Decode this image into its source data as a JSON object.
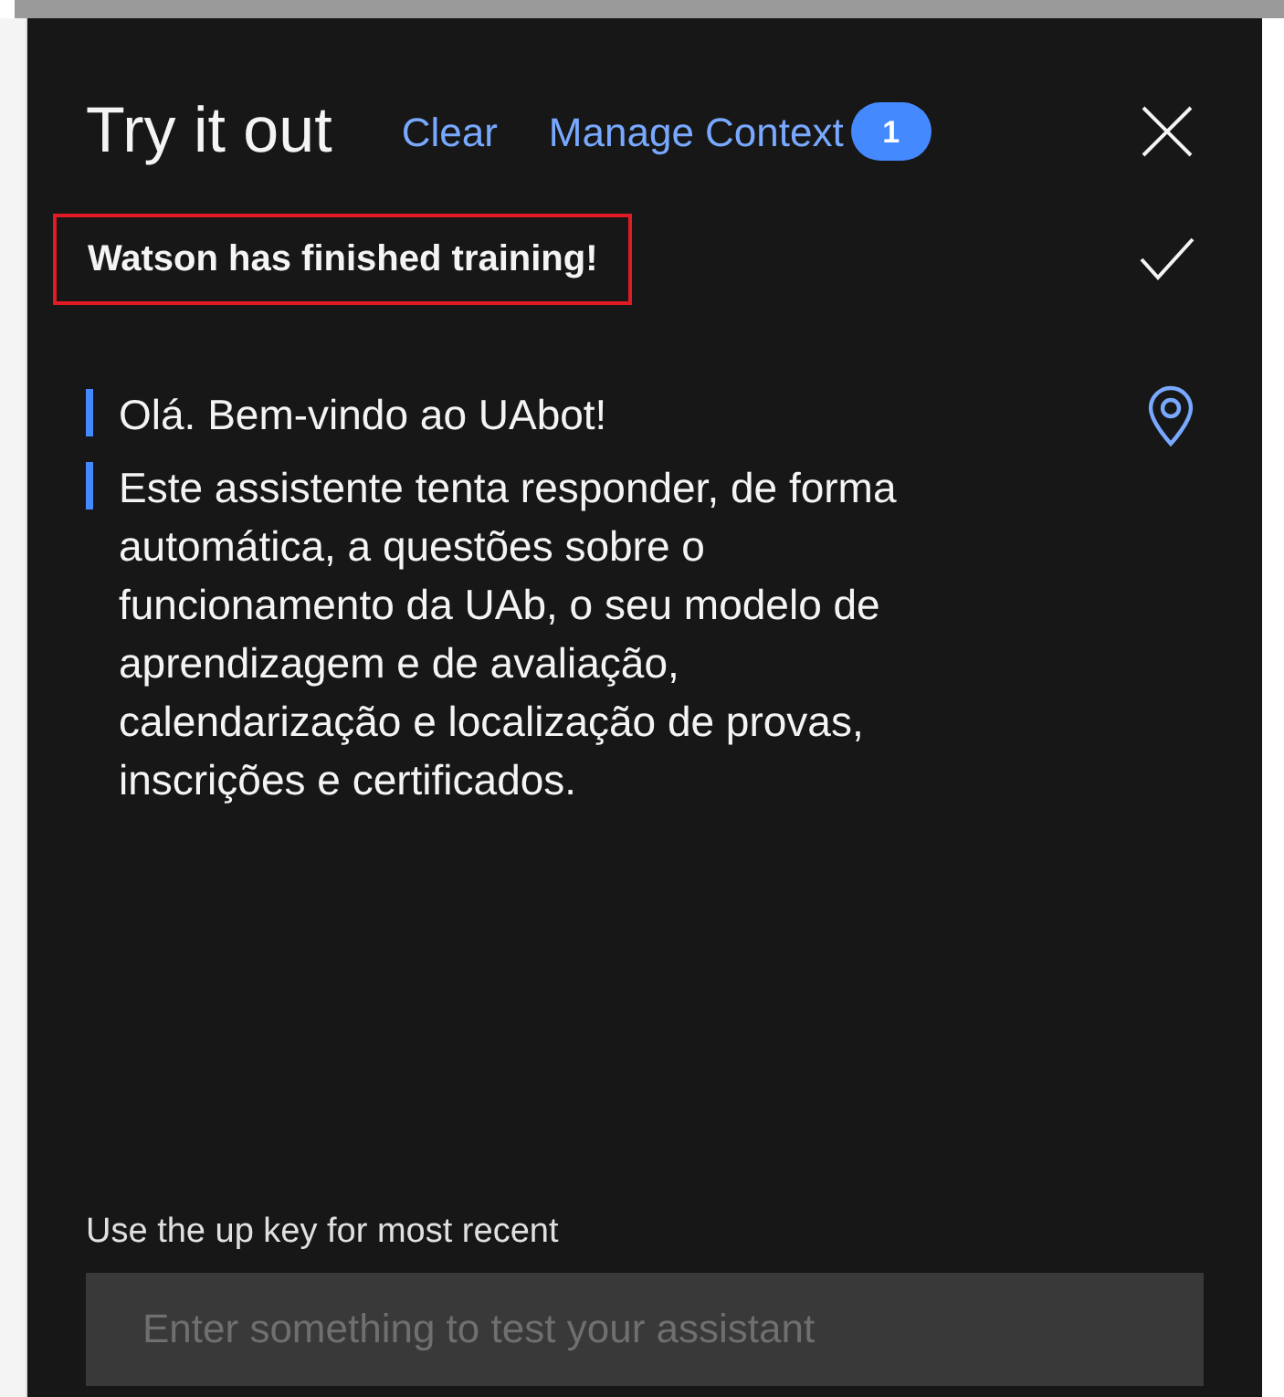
{
  "header": {
    "title": "Try it out",
    "clear_link": "Clear",
    "context_link": "Manage Context",
    "context_count": "1"
  },
  "status": {
    "text": "Watson has finished training!",
    "highlighted": true,
    "done": true
  },
  "messages": [
    {
      "text": "Olá. Bem-vindo ao UAbot!",
      "pinned": true
    },
    {
      "text": "Este assistente tenta responder, de forma automática, a questões sobre o funcionamento da UAb, o seu modelo de aprendizagem e de avaliação, calendarização e localização de provas, inscrições e certificados.",
      "pinned": false
    }
  ],
  "input": {
    "label": "Use the up key for most recent",
    "placeholder": "Enter something to test your assistant"
  }
}
